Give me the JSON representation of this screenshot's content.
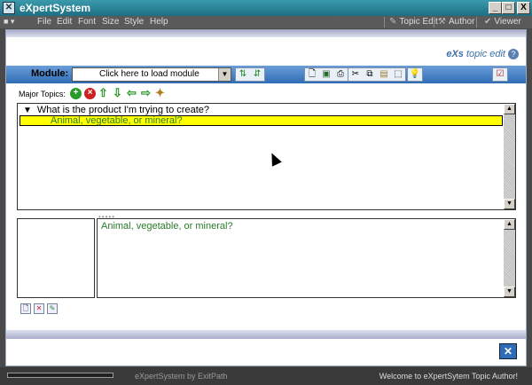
{
  "window": {
    "title": "eXpertSystem",
    "minimize": "_",
    "maximize": "□",
    "close": "X"
  },
  "menu": {
    "items": [
      "File",
      "Edit",
      "Font",
      "Size",
      "Style",
      "Help"
    ],
    "modes": [
      "Topic Edit",
      "Author",
      "Viewer"
    ]
  },
  "brand": {
    "prefix": "eXs",
    "suffix": " topic edit",
    "help": "?"
  },
  "module": {
    "label": "Module:",
    "select_value": "Click here to load module"
  },
  "topics": {
    "label": "Major Topics:",
    "question": "What is the product I'm trying to create?",
    "selected_item": "Animal, vegetable, or mineral?"
  },
  "detail": {
    "text": "Animal, vegetable, or mineral?"
  },
  "status": {
    "credit": "eXpertSystem by ExitPath",
    "welcome": "Welcome to eXpertSytem Topic Author!"
  },
  "colors": {
    "titlebar": "#1e6e82",
    "toolbar": "#2f6cb6",
    "highlight": "#ffff00",
    "topic_text": "#2a7a2a"
  }
}
